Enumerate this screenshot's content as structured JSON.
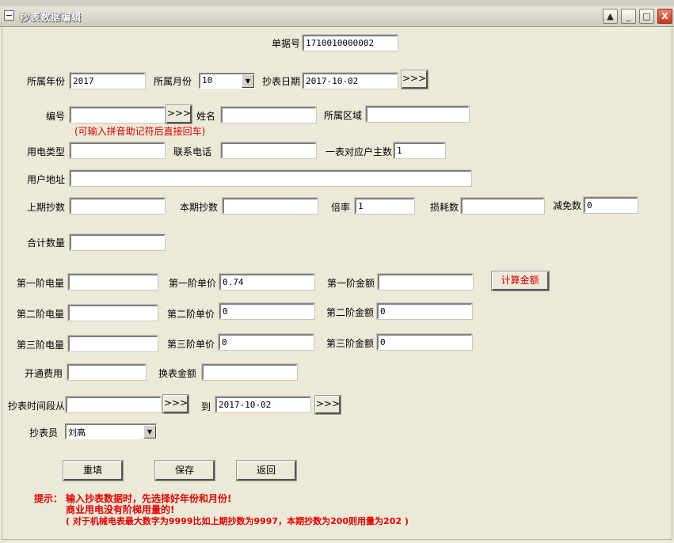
{
  "window": {
    "title": "抄表数据编辑",
    "controls": {
      "restore": "▲",
      "minimize": "_",
      "maximize": "□",
      "close": "X"
    }
  },
  "form": {
    "doc_no": {
      "label": "单据号",
      "value": "1710010000002"
    },
    "year": {
      "label": "所属年份",
      "value": "2017"
    },
    "month": {
      "label": "所属月份",
      "value": "10"
    },
    "read_date": {
      "label": "抄表日期",
      "value": "2017-10-02",
      "btn": ">>>"
    },
    "code": {
      "label": "编号",
      "value": "",
      "btn": ">>>"
    },
    "code_hint": "(可输入拼音助记符后直接回车)",
    "name": {
      "label": "姓名",
      "value": ""
    },
    "area": {
      "label": "所属区域",
      "value": ""
    },
    "power_type": {
      "label": "用电类型",
      "value": ""
    },
    "phone": {
      "label": "联系电话",
      "value": ""
    },
    "households": {
      "label": "一表对应户主数",
      "value": "1"
    },
    "address": {
      "label": "用户地址",
      "value": ""
    },
    "prev_reading": {
      "label": "上期抄数",
      "value": ""
    },
    "curr_reading": {
      "label": "本期抄数",
      "value": ""
    },
    "ratio": {
      "label": "倍率",
      "value": "1"
    },
    "loss": {
      "label": "损耗数",
      "value": ""
    },
    "exempt": {
      "label": "减免数",
      "value": "0"
    },
    "total": {
      "label": "合计数量",
      "value": ""
    },
    "tier1": {
      "qty_label": "第一阶电量",
      "qty": "",
      "price_label": "第一阶单价",
      "price": "0.74",
      "amt_label": "第一阶金额",
      "amt": ""
    },
    "tier2": {
      "qty_label": "第二阶电量",
      "qty": "",
      "price_label": "第二阶单价",
      "price": "0",
      "amt_label": "第二阶金额",
      "amt": "0"
    },
    "tier3": {
      "qty_label": "第三阶电量",
      "qty": "",
      "price_label": "第三阶单价",
      "price": "0",
      "amt_label": "第三阶金额",
      "amt": "0"
    },
    "calc_button": "计算金额",
    "open_fee": {
      "label": "开通费用",
      "value": ""
    },
    "replace_fee": {
      "label": "换表金额",
      "value": ""
    },
    "period_from": {
      "label": "抄表时间段从",
      "value": "",
      "btn": ">>>"
    },
    "period_to": {
      "label": "到",
      "value": "2017-10-02",
      "btn": ">>>"
    },
    "reader": {
      "label": "抄表员",
      "value": "刘高"
    }
  },
  "actions": {
    "reset": "重填",
    "save": "保存",
    "back": "返回"
  },
  "tips": {
    "prefix": "提示：",
    "line1": "输入抄表数据时，先选择好年份和月份!",
    "line2": "商业用电没有阶梯用量的!",
    "line3": "( 对于机械电表最大数字为9999比如上期抄数为9997，本期抄数为200则用量为202 )"
  },
  "colors": {
    "background": "#ece9d8",
    "tip": "#e00000",
    "hint": "#d40000"
  }
}
